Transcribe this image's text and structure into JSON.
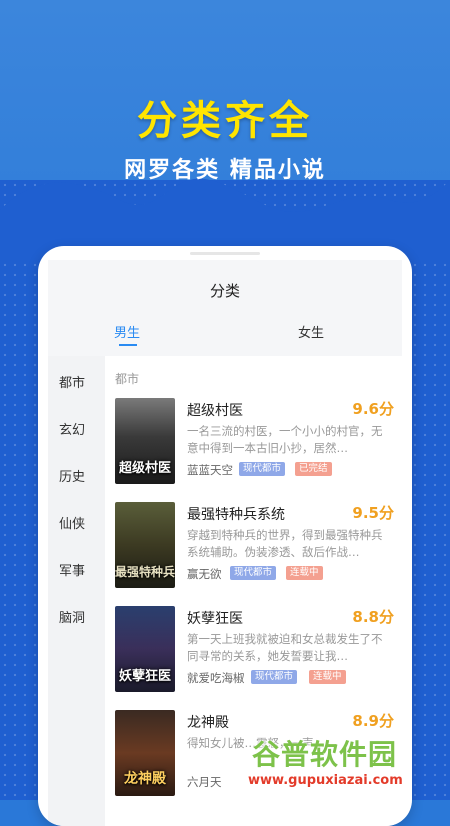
{
  "promo": {
    "headline": "分类齐全",
    "subline": "网罗各类 精品小说"
  },
  "app": {
    "page_title": "分类",
    "tabs": [
      {
        "label": "男生",
        "active": true
      },
      {
        "label": "女生",
        "active": false
      }
    ],
    "categories": [
      "都市",
      "玄幻",
      "历史",
      "仙侠",
      "军事",
      "脑洞"
    ],
    "section_label": "都市",
    "books": [
      {
        "title": "超级村医",
        "score": "9.6分",
        "desc": "一名三流的村医，一个小小的村官，无意中得到一本古旧小抄，居然…",
        "author": "蓝蓝天空",
        "tags": [
          "现代都市",
          "已完结"
        ],
        "cover_text": "超级村医"
      },
      {
        "title": "最强特种兵系统",
        "score": "9.5分",
        "desc": "穿越到特种兵的世界，得到最强特种兵系统辅助。伪装渗透、敌后作战…",
        "author": "赢无欲",
        "tags": [
          "现代都市",
          "连载中"
        ],
        "cover_text": "最强特种兵"
      },
      {
        "title": "妖孽狂医",
        "score": "8.8分",
        "desc": "第一天上班我就被迫和女总裁发生了不同寻常的关系，她发誓要让我…",
        "author": "就爱吃海椒",
        "tags": [
          "现代都市",
          "连载中"
        ],
        "cover_text": "妖孽狂医"
      },
      {
        "title": "龙神殿",
        "score": "8.9分",
        "desc": "得知女儿被…震怒，一声…",
        "author": "六月天",
        "tags": [],
        "cover_text": "龙神殿"
      }
    ]
  },
  "watermark": {
    "title": "谷普软件园",
    "url": "www.gupuxiazai.com"
  },
  "colors": {
    "accent": "#2a8bf2",
    "headline": "#ffe500",
    "score": "#f0a020",
    "background": "#1f5fd0"
  }
}
